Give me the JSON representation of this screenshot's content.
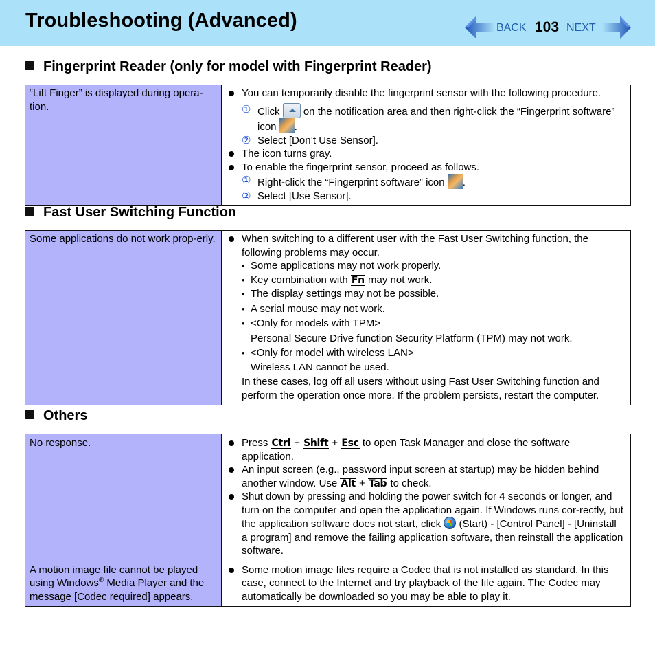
{
  "header": {
    "title": "Troubleshooting (Advanced)",
    "nav": {
      "back_label": "BACK",
      "page_number": "103",
      "next_label": "NEXT",
      "back_icon": "left-arrow-icon",
      "next_icon": "right-arrow-icon"
    }
  },
  "colors": {
    "header_bg": "#abe1f9",
    "condition_cell_bg": "#b3b3fb",
    "nav_link": "#1f5fae",
    "step_number": "#1a4ed8"
  },
  "sections": {
    "fingerprint": {
      "heading": "Fingerprint Reader (only for model with Fingerprint Reader)",
      "condition": "“Lift Finger” is displayed during opera-tion.",
      "b1": "You can temporarily disable the fingerprint sensor with the following procedure.",
      "s1_num": "①",
      "s1_a": "Click",
      "s1_icon1": "notification-area-up-arrow-icon",
      "s1_b": "on the notification area and then right-click the “Fingerprint software” icon",
      "s1_icon2": "fingerprint-software-icon",
      "s1_c": ".",
      "s2_num": "②",
      "s2": "Select [Don’t Use Sensor].",
      "b2": "The icon turns gray.",
      "b3": "To enable the fingerprint sensor, proceed as follows.",
      "s3_num": "①",
      "s3_a": "Right-click the “Fingerprint software” icon",
      "s3_b": ".",
      "s4_num": "②",
      "s4": "Select [Use Sensor]."
    },
    "fast_user": {
      "heading": "Fast User Switching Function",
      "condition": "Some applications do not work prop-erly.",
      "b1": "When switching to a different user with the Fast User Switching function, the following problems may occur.",
      "d1": "Some applications may not work properly.",
      "d2_a": "Key combination with",
      "d2_key": "Fn",
      "d2_b": "may not work.",
      "d3": "The display settings may not be possible.",
      "d4": "A serial mouse may not work.",
      "d5": "<Only for models with TPM>",
      "d5_cont": "Personal Secure Drive function Security Platform (TPM) may not work.",
      "d6": "<Only for model with wireless LAN>",
      "d6_cont": "Wireless LAN cannot be used.",
      "closing": "In these cases, log off all users without using Fast User Switching function and perform the operation once more. If the problem persists, restart the computer."
    },
    "others": {
      "heading": "Others",
      "row1": {
        "condition": "No response.",
        "b1_a": "Press",
        "key_ctrl": "Ctrl",
        "plus": "+",
        "key_shift": "Shift",
        "key_esc": "Esc",
        "b1_b": "to open Task Manager and close the software application.",
        "b2_a": "An input screen (e.g., password input screen at startup) may be hidden behind another window. Use",
        "key_alt": "Alt",
        "key_tab": "Tab",
        "b2_b": "to check.",
        "b3_a": "Shut down by pressing and holding the power switch for 4 seconds or longer, and turn on the computer and open the application again. If Windows runs cor-rectly, but the application software does not start, click",
        "b3_icon": "windows-start-icon",
        "b3_b": "(Start) - [Control Panel] - [Uninstall a program] and remove the failing application software, then reinstall the application software."
      },
      "row2": {
        "condition_a": "A motion image file cannot be played using Windows",
        "condition_sup": "®",
        "condition_b": " Media Player and the message [Codec required] appears.",
        "b1": "Some motion image files require a Codec that is not installed as standard. In this case, connect to the Internet and try playback of the file again. The Codec may automatically be downloaded so you may be able to play it."
      }
    }
  }
}
